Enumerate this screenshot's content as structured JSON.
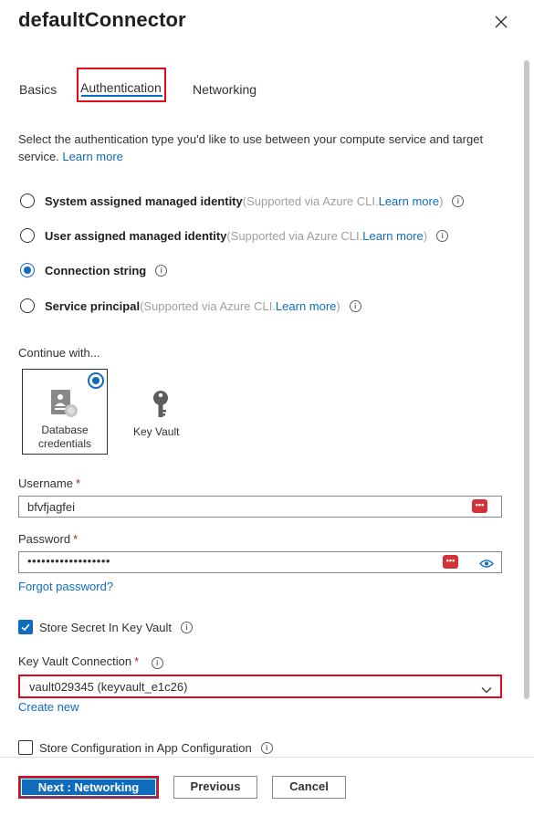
{
  "header": {
    "title": "defaultConnector"
  },
  "tabs": [
    {
      "label": "Basics"
    },
    {
      "label": "Authentication",
      "active": true
    },
    {
      "label": "Networking"
    }
  ],
  "auth": {
    "description": "Select the authentication type you'd like to use between your compute service and target service.",
    "learn_more": "Learn more",
    "options": [
      {
        "label": "System assigned managed identity",
        "note_prefix": "(Supported via Azure CLI. ",
        "note_link": "Learn more",
        "note_suffix": ")",
        "selected": false
      },
      {
        "label": "User assigned managed identity",
        "note_prefix": "(Supported via Azure CLI. ",
        "note_link": "Learn more",
        "note_suffix": ")",
        "selected": false
      },
      {
        "label": "Connection string",
        "note_prefix": "",
        "note_link": "",
        "note_suffix": "",
        "selected": true
      },
      {
        "label": "Service principal",
        "note_prefix": "(Supported via Azure CLI. ",
        "note_link": "Learn more",
        "note_suffix": ")",
        "selected": false
      }
    ]
  },
  "continue": {
    "label": "Continue with...",
    "cards": [
      {
        "label": "Database credentials",
        "icon": "database-credentials-icon",
        "selected": true
      },
      {
        "label": "Key Vault",
        "icon": "key-icon",
        "selected": false
      }
    ]
  },
  "form": {
    "username_label": "Username",
    "username_value": "bfvfjagfei",
    "password_label": "Password",
    "password_value": "••••••••••••••••••",
    "required_mark": "*",
    "forgot_password": "Forgot password?",
    "store_secret_label": "Store Secret In Key Vault",
    "store_secret_checked": true,
    "kv_connection_label": "Key Vault Connection",
    "kv_connection_value": "vault029345 (keyvault_e1c26)",
    "create_new": "Create new",
    "store_config_label": "Store Configuration in App Configuration",
    "store_config_checked": false
  },
  "footer": {
    "next_label": "Next : Networking",
    "previous_label": "Previous",
    "cancel_label": "Cancel"
  },
  "colors": {
    "accent": "#0f6cbd",
    "highlight": "#e00b1c",
    "password_manager": "#d13438"
  }
}
